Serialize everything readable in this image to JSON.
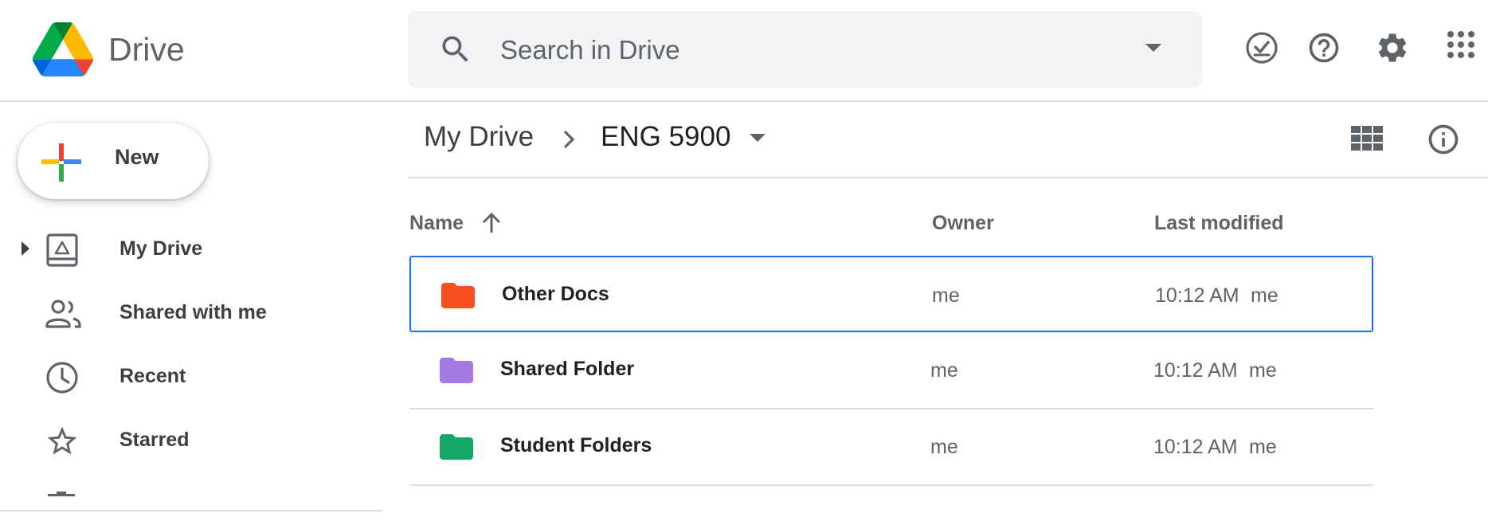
{
  "app": {
    "name": "Drive"
  },
  "search": {
    "placeholder": "Search in Drive"
  },
  "header_icons": [
    "ready-for-offline-icon",
    "help-icon",
    "settings-icon",
    "apps-grid-icon"
  ],
  "sidebar": {
    "new_label": "New",
    "items": [
      {
        "label": "My Drive",
        "icon": "my-drive-icon",
        "expandable": true
      },
      {
        "label": "Shared with me",
        "icon": "people-icon"
      },
      {
        "label": "Recent",
        "icon": "clock-icon"
      },
      {
        "label": "Starred",
        "icon": "star-icon"
      }
    ]
  },
  "breadcrumb": {
    "root": "My Drive",
    "current": "ENG 5900"
  },
  "file_list": {
    "columns": {
      "name": "Name",
      "owner": "Owner",
      "modified": "Last modified"
    },
    "sort": {
      "column": "Name",
      "direction": "ascending"
    },
    "rows": [
      {
        "name": "Other Docs",
        "owner": "me",
        "modified_time": "10:12 AM",
        "modified_by": "me",
        "folder_color": "#f4511e",
        "selected": true
      },
      {
        "name": "Shared Folder",
        "owner": "me",
        "modified_time": "10:12 AM",
        "modified_by": "me",
        "folder_color": "#a479e2",
        "selected": false
      },
      {
        "name": "Student Folders",
        "owner": "me",
        "modified_time": "10:12 AM",
        "modified_by": "me",
        "folder_color": "#16a765",
        "selected": false
      }
    ]
  },
  "colors": {
    "accent": "#1a73e8",
    "divider": "#dadce0",
    "search_bg": "#f1f3f4"
  }
}
